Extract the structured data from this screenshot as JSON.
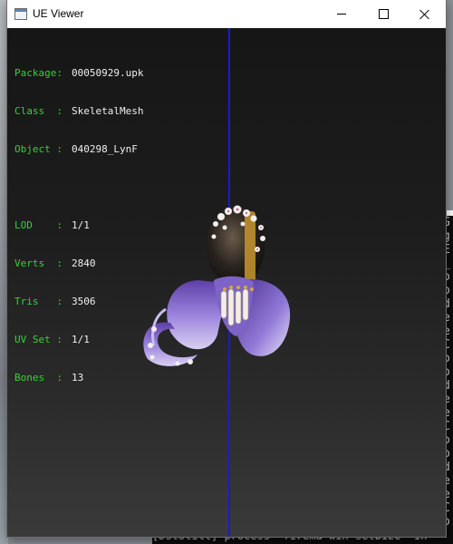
{
  "window": {
    "title": "UE Viewer"
  },
  "info": {
    "package_label": "Package",
    "package": "00050929.upk",
    "class_label": "Class",
    "class": "SkeletalMesh",
    "object_label": "Object",
    "object": "040298_LynF",
    "lod_label": "LOD",
    "lod": "1/1",
    "verts_label": "Verts",
    "verts": "2840",
    "tris_label": "Tris",
    "tris": "3506",
    "uvset_label": "UV Set",
    "uvset": "1/1",
    "bones_label": "Bones",
    "bones": "13"
  },
  "console": {
    "bottom_line": "[Dstotill] process  firema win setbize  In"
  },
  "colors": {
    "label_green": "#36d236",
    "value_white": "#f0f0f0",
    "axis_blue": "#1a1ad6",
    "hair_purple": "#8a6fd0"
  }
}
